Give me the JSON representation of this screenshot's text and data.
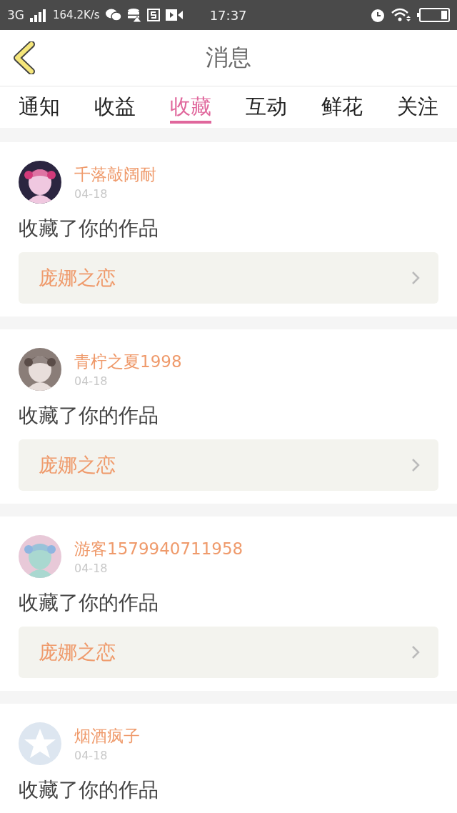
{
  "status_bar": {
    "network": "3G",
    "speed": "164.2K/s",
    "time": "17:37"
  },
  "header": {
    "title": "消息"
  },
  "tabs": [
    {
      "label": "通知",
      "selected": false
    },
    {
      "label": "收益",
      "selected": false
    },
    {
      "label": "收藏",
      "selected": true
    },
    {
      "label": "互动",
      "selected": false
    },
    {
      "label": "鲜花",
      "selected": false
    },
    {
      "label": "关注",
      "selected": false
    }
  ],
  "messages": [
    {
      "user": "千落敲阔耐",
      "date": "04-18",
      "action": "收藏了你的作品",
      "work": "庞娜之恋"
    },
    {
      "user": "青柠之夏1998",
      "date": "04-18",
      "action": "收藏了你的作品",
      "work": "庞娜之恋"
    },
    {
      "user": "游客1579940711958",
      "date": "04-18",
      "action": "收藏了你的作品",
      "work": "庞娜之恋"
    },
    {
      "user": "烟酒疯子",
      "date": "04-18",
      "avatar": {
        "kind": "default"
      },
      "action": "收藏了你的作品"
    }
  ]
}
